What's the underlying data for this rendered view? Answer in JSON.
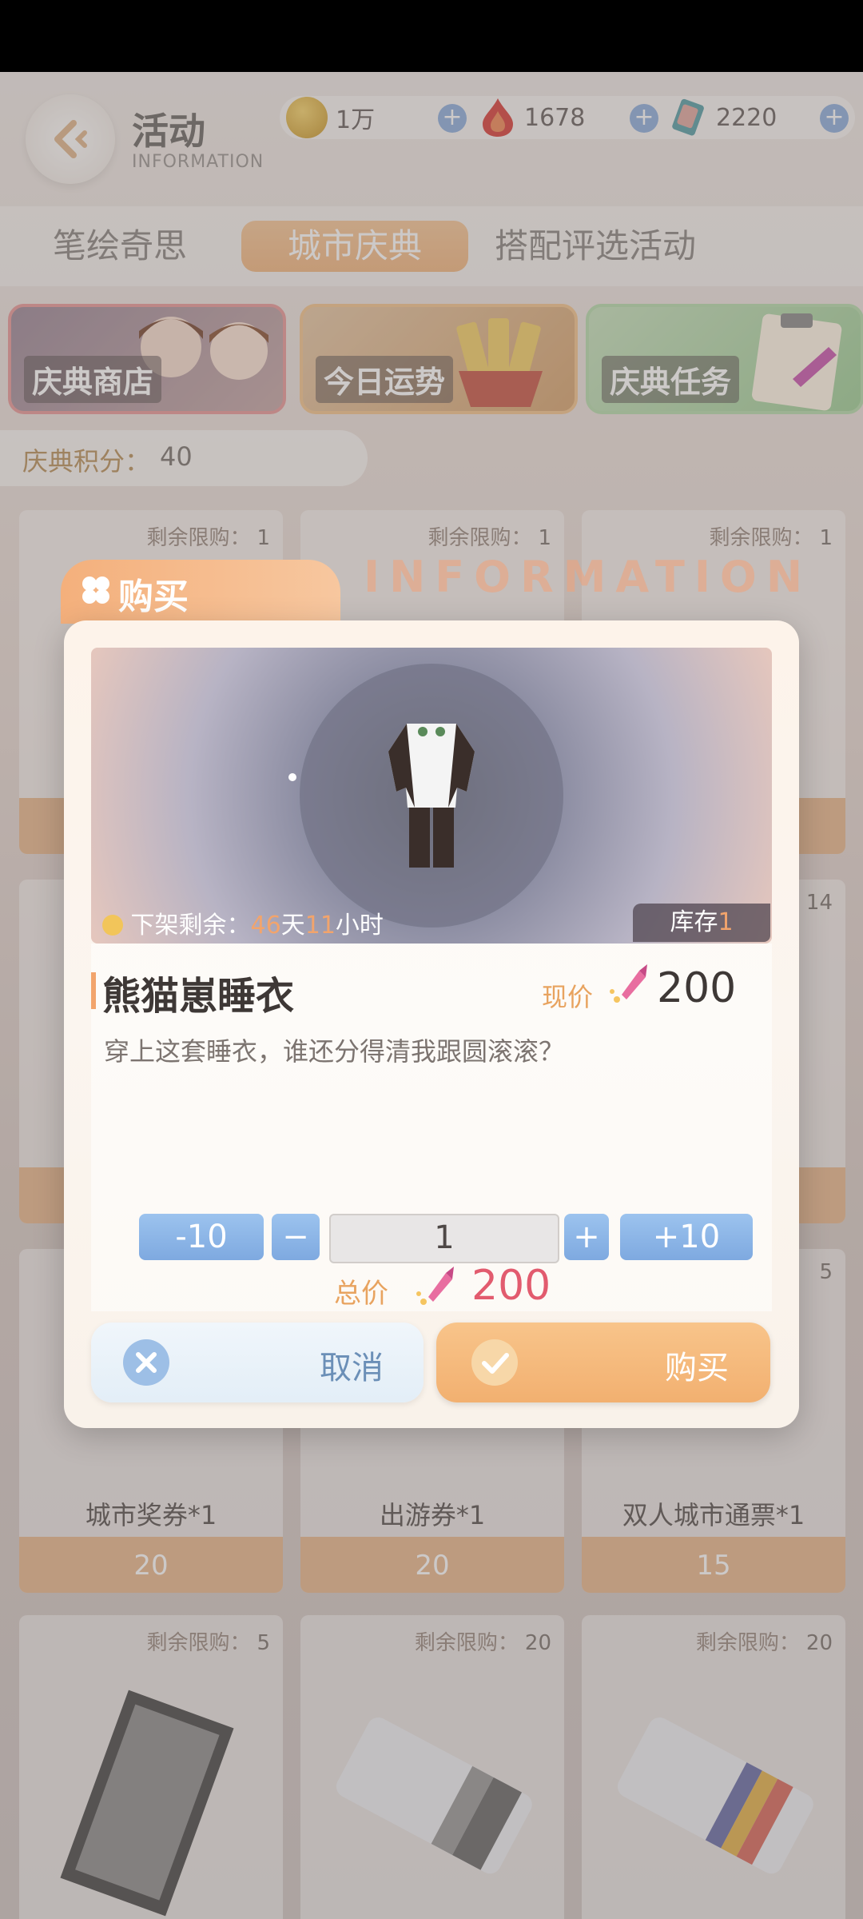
{
  "header": {
    "title": "活动",
    "subtitle": "INFORMATION",
    "currencies": [
      {
        "icon": "gold-coin-icon",
        "value": "1万"
      },
      {
        "icon": "red-gem-icon",
        "value": "1678"
      },
      {
        "icon": "card-ticket-icon",
        "value": "2220"
      }
    ]
  },
  "tabs": [
    {
      "label": "笔绘奇思",
      "active": false
    },
    {
      "label": "城市庆典",
      "active": true
    },
    {
      "label": "搭配评选活动",
      "active": false
    }
  ],
  "features": [
    {
      "label": "庆典商店"
    },
    {
      "label": "今日运势"
    },
    {
      "label": "庆典任务"
    }
  ],
  "points": {
    "label": "庆典积分：",
    "value": "40"
  },
  "grid": {
    "limit_label": "剩余限购：",
    "row1": [
      {
        "limit": "1"
      },
      {
        "limit": "1"
      },
      {
        "limit": "1"
      }
    ],
    "row2_right_limit": "14",
    "row3": [
      {
        "name": "城市奖券*1",
        "price": "20"
      },
      {
        "name": "出游券*1",
        "price": "20"
      },
      {
        "name": "双人城市通票*1",
        "price": "15",
        "limit": "5"
      }
    ],
    "row4": [
      {
        "limit": "5"
      },
      {
        "limit": "20"
      },
      {
        "limit": "20"
      }
    ]
  },
  "modal": {
    "title": "购买",
    "watermark": "INFORMATION",
    "timer_label": "下架剩余：",
    "timer_days": "46",
    "timer_day_unit": "天",
    "timer_hours": "11",
    "timer_hour_unit": "小时",
    "stock_label": "库存",
    "stock_value": "1",
    "item_name": "熊猫崽睡衣",
    "current_price_label": "现价",
    "current_price": "200",
    "description": "穿上这套睡衣，谁还分得清我跟圆滚滚？",
    "qty_minus10": "-10",
    "qty_minus": "−",
    "qty_value": "1",
    "qty_plus": "+",
    "qty_plus10": "+10",
    "total_label": "总价",
    "total_price": "200",
    "cancel_label": "取消",
    "buy_label": "购买"
  }
}
